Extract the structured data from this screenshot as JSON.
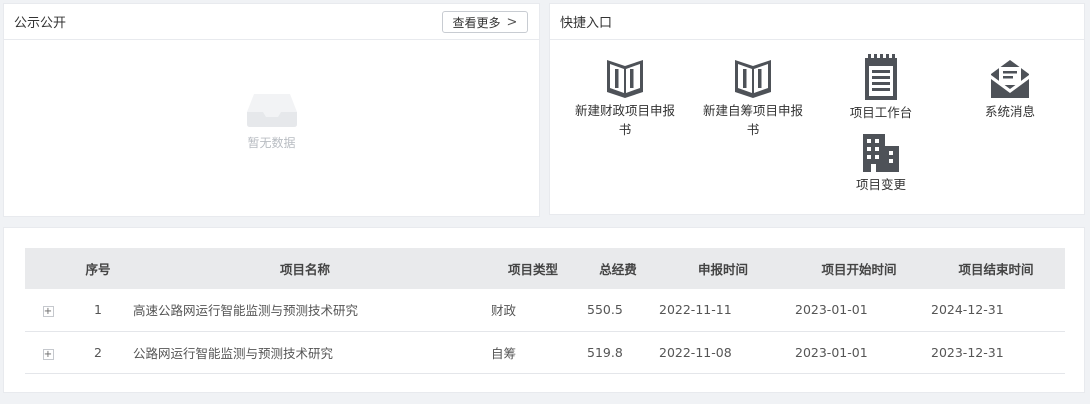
{
  "notice": {
    "title": "公示公开",
    "more_label": "查看更多",
    "empty_text": "暂无数据"
  },
  "quick": {
    "title": "快捷入口",
    "items": [
      {
        "label": "新建财政项目申报书",
        "icon": "book-icon"
      },
      {
        "label": "新建自筹项目申报书",
        "icon": "book-icon"
      },
      {
        "label": "项目工作台",
        "icon": "notepad-icon"
      },
      {
        "label": "系统消息",
        "icon": "envelope-icon"
      },
      {
        "label": "项目变更",
        "icon": "building-icon"
      }
    ]
  },
  "projects": {
    "headers": [
      "序号",
      "项目名称",
      "项目类型",
      "总经费",
      "申报时间",
      "项目开始时间",
      "项目结束时间"
    ],
    "rows": [
      {
        "expand": "+",
        "index": "1",
        "name": "高速公路网运行智能监测与预测技术研究",
        "type": "财政",
        "budget": "550.5",
        "apply_date": "2022-11-11",
        "start_date": "2023-01-01",
        "end_date": "2024-12-31"
      },
      {
        "expand": "+",
        "index": "2",
        "name": "公路网运行智能监测与预测技术研究",
        "type": "自筹",
        "budget": "519.8",
        "apply_date": "2022-11-08",
        "start_date": "2023-01-01",
        "end_date": "2023-12-31"
      }
    ]
  }
}
